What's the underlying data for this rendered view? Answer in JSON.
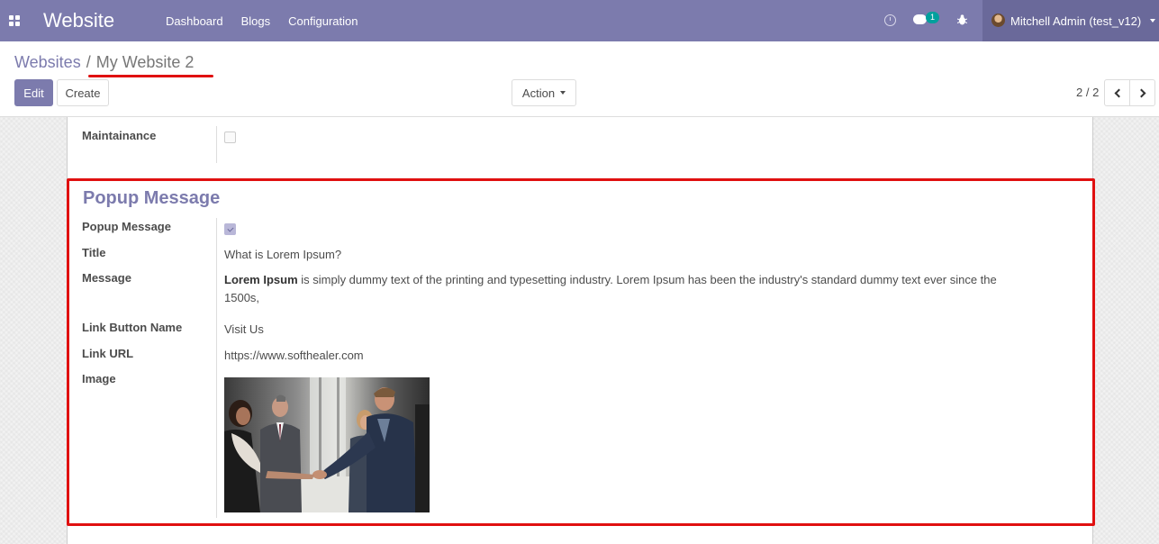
{
  "navbar": {
    "brand": "Website",
    "menu": [
      "Dashboard",
      "Blogs",
      "Configuration"
    ],
    "chat_badge": "1",
    "user": "Mitchell Admin (test_v12)"
  },
  "breadcrumb": {
    "parent": "Websites",
    "separator": "/",
    "current": "My Website 2"
  },
  "buttons": {
    "edit": "Edit",
    "create": "Create",
    "action": "Action"
  },
  "pager": {
    "value": "2 / 2"
  },
  "form": {
    "maintainance_label": "Maintainance",
    "maintainance_checked": false,
    "group_title": "Popup Message",
    "fields": {
      "popup_label": "Popup Message",
      "popup_checked": true,
      "title_label": "Title",
      "title_value": "What is Lorem Ipsum?",
      "message_label": "Message",
      "message_bold": "Lorem Ipsum",
      "message_rest": " is simply dummy text of the printing and typesetting industry. Lorem Ipsum has been the industry's standard dummy text ever since the 1500s,",
      "link_name_label": "Link Button Name",
      "link_name_value": "Visit Us",
      "link_url_label": "Link URL",
      "link_url_value": "https://www.softhealer.com",
      "image_label": "Image"
    }
  },
  "colors": {
    "navbar": "#7c7bad",
    "primary": "#7c7bad",
    "highlight": "#e01010"
  }
}
